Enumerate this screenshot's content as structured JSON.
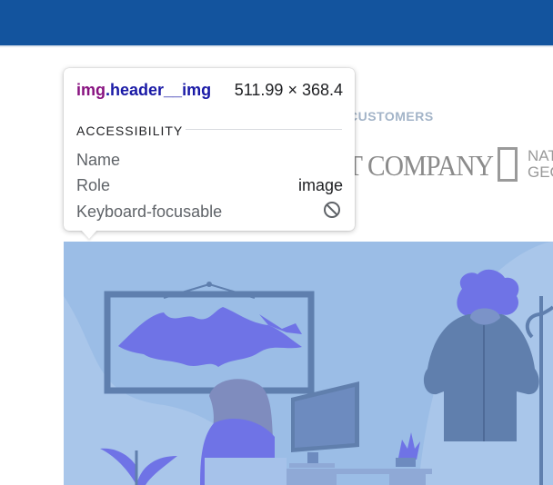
{
  "page": {
    "customers_label": "CUSTOMERS",
    "logos": {
      "fast_company": "T COMPANY",
      "nat_geo": "NAT\nGEO"
    }
  },
  "inspector_tooltip": {
    "tag": "img",
    "class_name": ".header__img",
    "size": "511.99 × 368.4",
    "section_title": "ACCESSIBILITY",
    "rows": [
      {
        "label": "Name",
        "value": ""
      },
      {
        "label": "Role",
        "value": "image"
      },
      {
        "label": "Keyboard-focusable",
        "value": "",
        "icon": "not-allowed-icon"
      }
    ]
  },
  "colors": {
    "topbar": "#13549e",
    "illustration_bg": "#9bbde6",
    "accent_purple": "#6f73e6"
  }
}
